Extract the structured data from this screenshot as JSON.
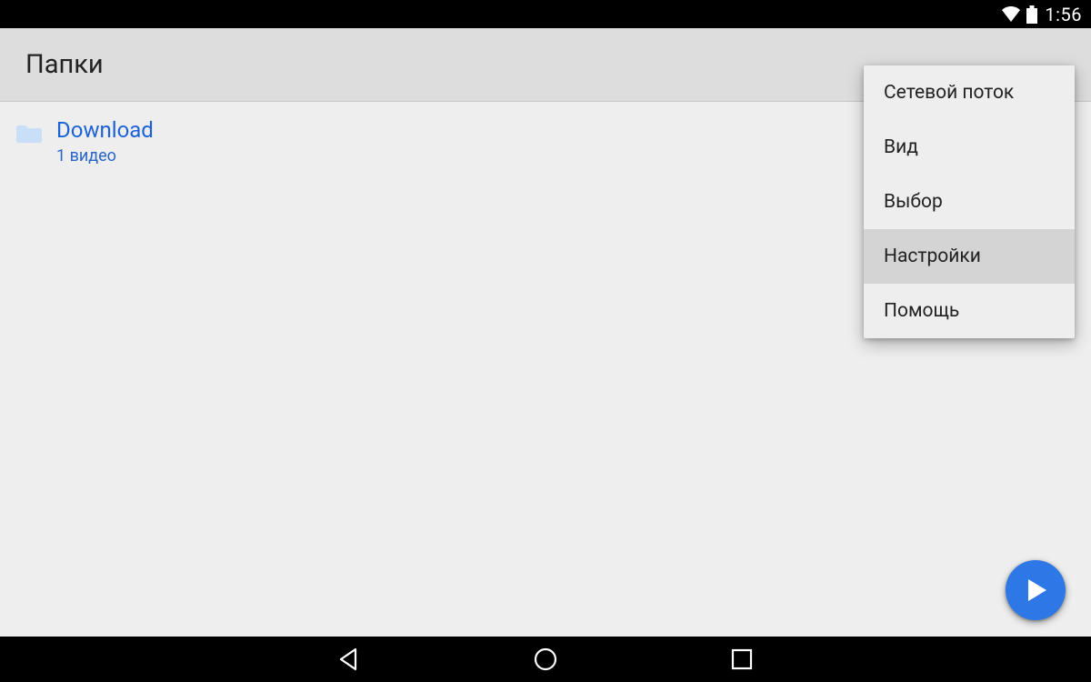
{
  "statusbar": {
    "time": "1:56"
  },
  "header": {
    "title": "Папки"
  },
  "folder": {
    "name": "Download",
    "subtitle": "1 видео"
  },
  "menu": {
    "items": [
      {
        "label": "Сетевой поток",
        "highlight": false
      },
      {
        "label": "Вид",
        "highlight": false
      },
      {
        "label": "Выбор",
        "highlight": false
      },
      {
        "label": "Настройки",
        "highlight": true
      },
      {
        "label": "Помощь",
        "highlight": false
      }
    ]
  }
}
